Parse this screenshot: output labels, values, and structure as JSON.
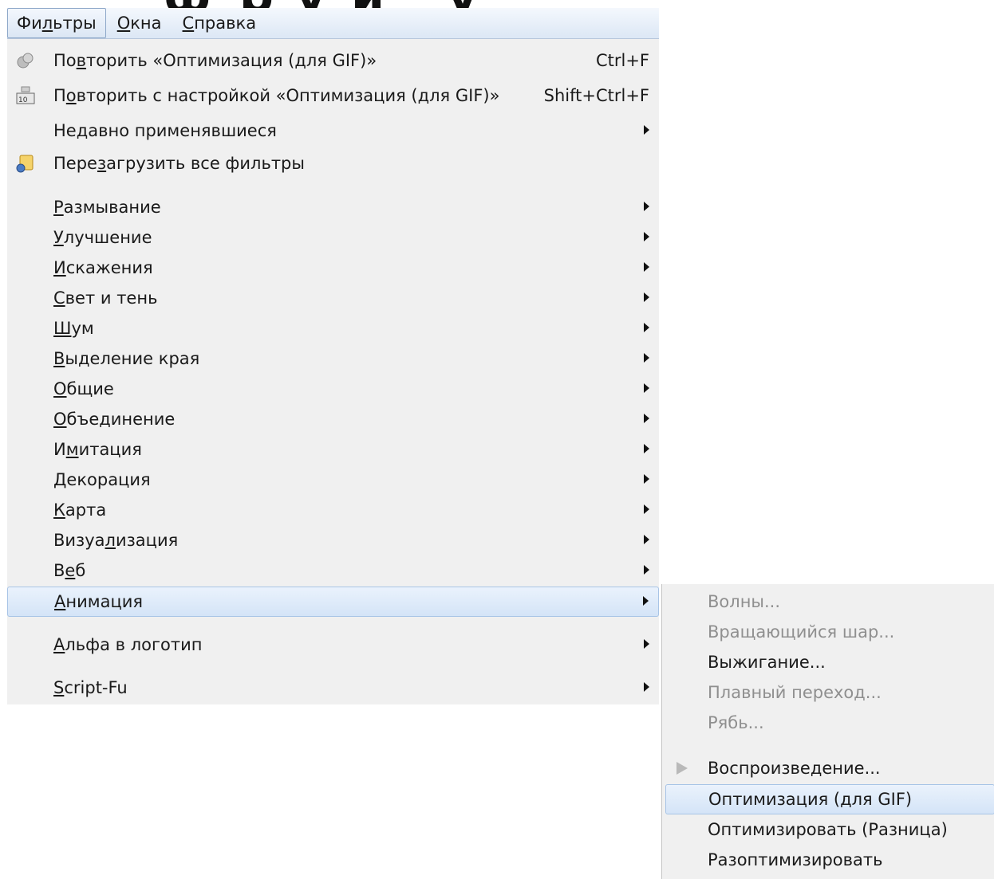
{
  "menubar": {
    "items": [
      {
        "pre": "Фи",
        "ul": "л",
        "post": "ьтры"
      },
      {
        "pre": "",
        "ul": "О",
        "post": "кна"
      },
      {
        "pre": "",
        "ul": "С",
        "post": "правка"
      }
    ]
  },
  "filters_menu": {
    "repeat": {
      "pre": "По",
      "ul": "в",
      "post": "торить «Оптимизация (для GIF)»",
      "shortcut": "Ctrl+F",
      "icon": "repeat-filter-icon"
    },
    "reshow": {
      "pre": "П",
      "ul": "о",
      "post": "вторить с настройкой «Оптимизация (для GIF)»",
      "shortcut": "Shift+Ctrl+F",
      "icon": "reshow-filter-icon"
    },
    "recent": {
      "pre": "Недавно применявшиеся",
      "ul": "",
      "post": ""
    },
    "reload": {
      "pre": "Пере",
      "ul": "з",
      "post": "агрузить все фильтры",
      "icon": "reload-filters-icon"
    },
    "blur": {
      "pre": "",
      "ul": "Р",
      "post": "азмывание"
    },
    "enhance": {
      "pre": "",
      "ul": "У",
      "post": "лучшение"
    },
    "distorts": {
      "pre": "",
      "ul": "И",
      "post": "скажения"
    },
    "light_shadow": {
      "pre": "",
      "ul": "С",
      "post": "вет и тень"
    },
    "noise": {
      "pre": "",
      "ul": "Ш",
      "post": "ум"
    },
    "edge_detect": {
      "pre": "",
      "ul": "В",
      "post": "ыделение края"
    },
    "generic": {
      "pre": "",
      "ul": "О",
      "post": "бщие"
    },
    "combine": {
      "pre": "",
      "ul": "О",
      "post": "бъединение"
    },
    "artistic": {
      "pre": "И",
      "ul": "м",
      "post": "итация"
    },
    "decor": {
      "pre": "",
      "ul": "Д",
      "post": "екорация"
    },
    "map": {
      "pre": "",
      "ul": "К",
      "post": "арта"
    },
    "render": {
      "pre": "Визуа",
      "ul": "л",
      "post": "изация"
    },
    "web": {
      "pre": "В",
      "ul": "е",
      "post": "б"
    },
    "animation": {
      "pre": "",
      "ul": "А",
      "post": "нимация"
    },
    "alpha_logo": {
      "pre": "",
      "ul": "А",
      "post": "льфа в логотип"
    },
    "script_fu": {
      "pre": "",
      "ul": "S",
      "post": "cript-Fu"
    }
  },
  "animation_submenu": {
    "waves": {
      "pre": "",
      "ul": "В",
      "post": "олны..."
    },
    "spinning": {
      "pre": "Вращающийся ",
      "ul": "ш",
      "post": "ар..."
    },
    "burn_in": {
      "pre": "В",
      "ul": "ы",
      "post": "жигание..."
    },
    "blend": {
      "pre": "",
      "ul": "П",
      "post": "лавный переход..."
    },
    "rippling": {
      "pre": "",
      "ul": "Р",
      "post": "ябь..."
    },
    "playback": {
      "pre": "",
      "ul": "В",
      "post": "оспроизведение...",
      "icon": "playback-icon"
    },
    "optimize_gif": {
      "pre": "Оптимизация (для ",
      "ul": "G",
      "post": "IF)"
    },
    "optimize_diff": {
      "pre": "",
      "ul": "О",
      "post": "птимизировать (Разница)"
    },
    "unoptimize": {
      "pre": "",
      "ul": "Р",
      "post": "азоптимизировать"
    }
  }
}
